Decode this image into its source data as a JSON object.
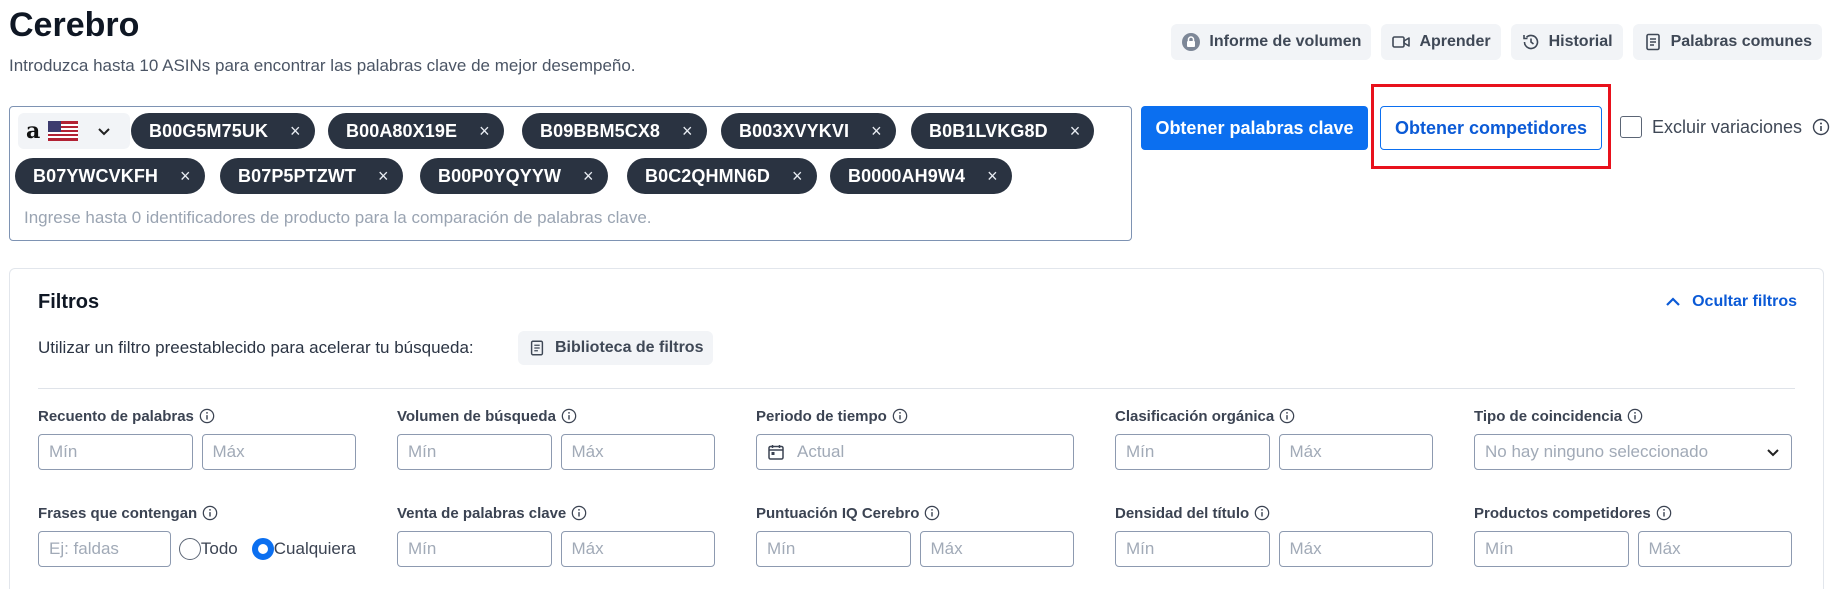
{
  "header": {
    "title": "Cerebro",
    "subtitle": "Introduzca hasta 10 ASINs para encontrar las palabras clave de mejor desempeño."
  },
  "top_actions": [
    {
      "label": "Informe de volumen",
      "icon": "lock-icon"
    },
    {
      "label": "Aprender",
      "icon": "video-icon"
    },
    {
      "label": "Historial",
      "icon": "history-icon"
    },
    {
      "label": "Palabras comunes",
      "icon": "document-icon"
    }
  ],
  "asin_input": {
    "marketplace": {
      "logo": "a",
      "flag": "us-flag-icon"
    },
    "chips": [
      "B00G5M75UK",
      "B00A80X19E",
      "B09BBM5CX8",
      "B003XVYKVI",
      "B0B1LVKG8D",
      "B07YWCVKFH",
      "B07P5PTZWT",
      "B00P0YQYYW",
      "B0C2QHMN6D",
      "B0000AH9W4"
    ],
    "remove_glyph": "×",
    "placeholder": "Ingrese hasta 0 identificadores de producto para la comparación de palabras clave."
  },
  "actions": {
    "get_keywords": "Obtener palabras clave",
    "get_competitors": "Obtener competidores",
    "exclude_variations": "Excluir variaciones"
  },
  "filters": {
    "title": "Filtros",
    "hide_label": "Ocultar filtros",
    "preset_label": "Utilizar un filtro preestablecido para acelerar tu búsqueda:",
    "library_label": "Biblioteca de filtros",
    "min": "Mín",
    "max": "Máx",
    "word_count": "Recuento de palabras",
    "search_volume": "Volumen de búsqueda",
    "time_period": "Periodo de tiempo",
    "time_value": "Actual",
    "organic_rank": "Clasificación orgánica",
    "match_type": "Tipo de coincidencia",
    "match_value": "No hay ninguno seleccionado",
    "phrases": "Frases que contengan",
    "phrases_placeholder": "Ej: faldas",
    "all": "Todo",
    "any": "Cualquiera",
    "keyword_sales": "Venta de palabras clave",
    "iq_score": "Puntuación IQ Cerebro",
    "title_density": "Densidad del título",
    "competing_products": "Productos competidores"
  },
  "colors": {
    "primary": "#0b6ff0",
    "chip_bg": "#2a3341",
    "highlight": "#e8111c"
  }
}
